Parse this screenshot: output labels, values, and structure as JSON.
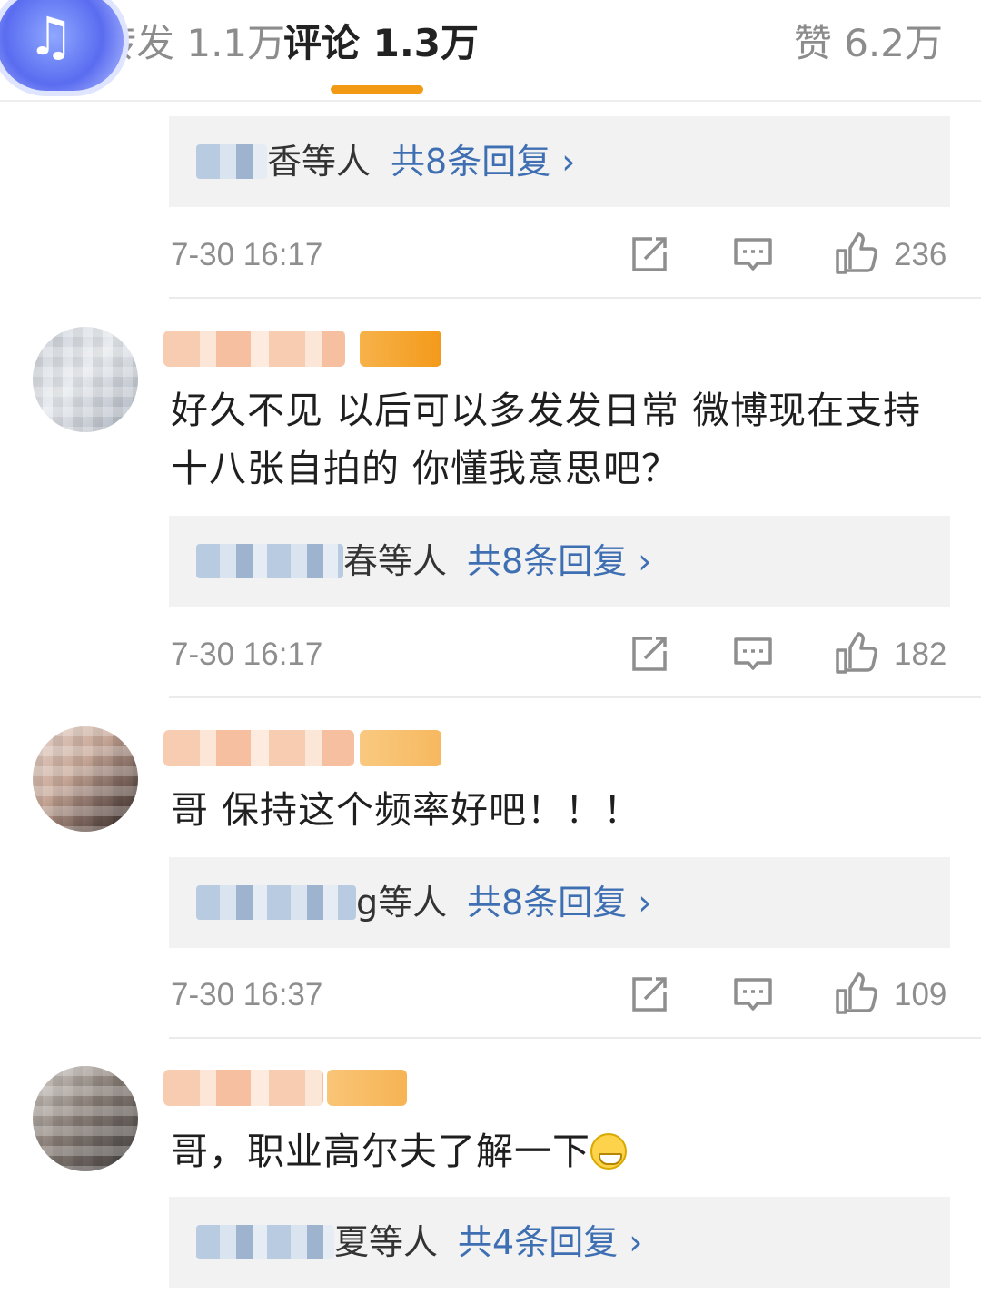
{
  "tabs": {
    "repost": "转发 1.1万",
    "comment": "评论 1.3万",
    "like": "赞 6.2万",
    "active_color": "#f29a14"
  },
  "icons": {
    "music": "music-note-icon",
    "share": "share-icon",
    "comment": "comment-icon",
    "like": "thumbs-up-icon"
  },
  "comments": [
    {
      "text": "",
      "reply_suffix": "香等人",
      "reply_count": "共8条回复 ›",
      "time": "7-30 16:17",
      "likes": "236"
    },
    {
      "text": "好久不见 以后可以多发发日常 微博现在支持十八张自拍的 你懂我意思吧？",
      "reply_suffix": "春等人",
      "reply_count": "共8条回复 ›",
      "time": "7-30 16:17",
      "likes": "182"
    },
    {
      "text": "哥 保持这个频率好吧！！！",
      "reply_suffix": "g等人",
      "reply_count": "共8条回复 ›",
      "time": "7-30 16:37",
      "likes": "109"
    },
    {
      "text": "哥，职业高尔夫了解一下",
      "reply_suffix": "夏等人",
      "reply_count": "共4条回复 ›",
      "time": "",
      "likes": ""
    }
  ],
  "colors": {
    "link_blue": "#3f6fb3",
    "meta_gray": "#8e8e8e",
    "reply_bg": "#f2f2f2"
  }
}
